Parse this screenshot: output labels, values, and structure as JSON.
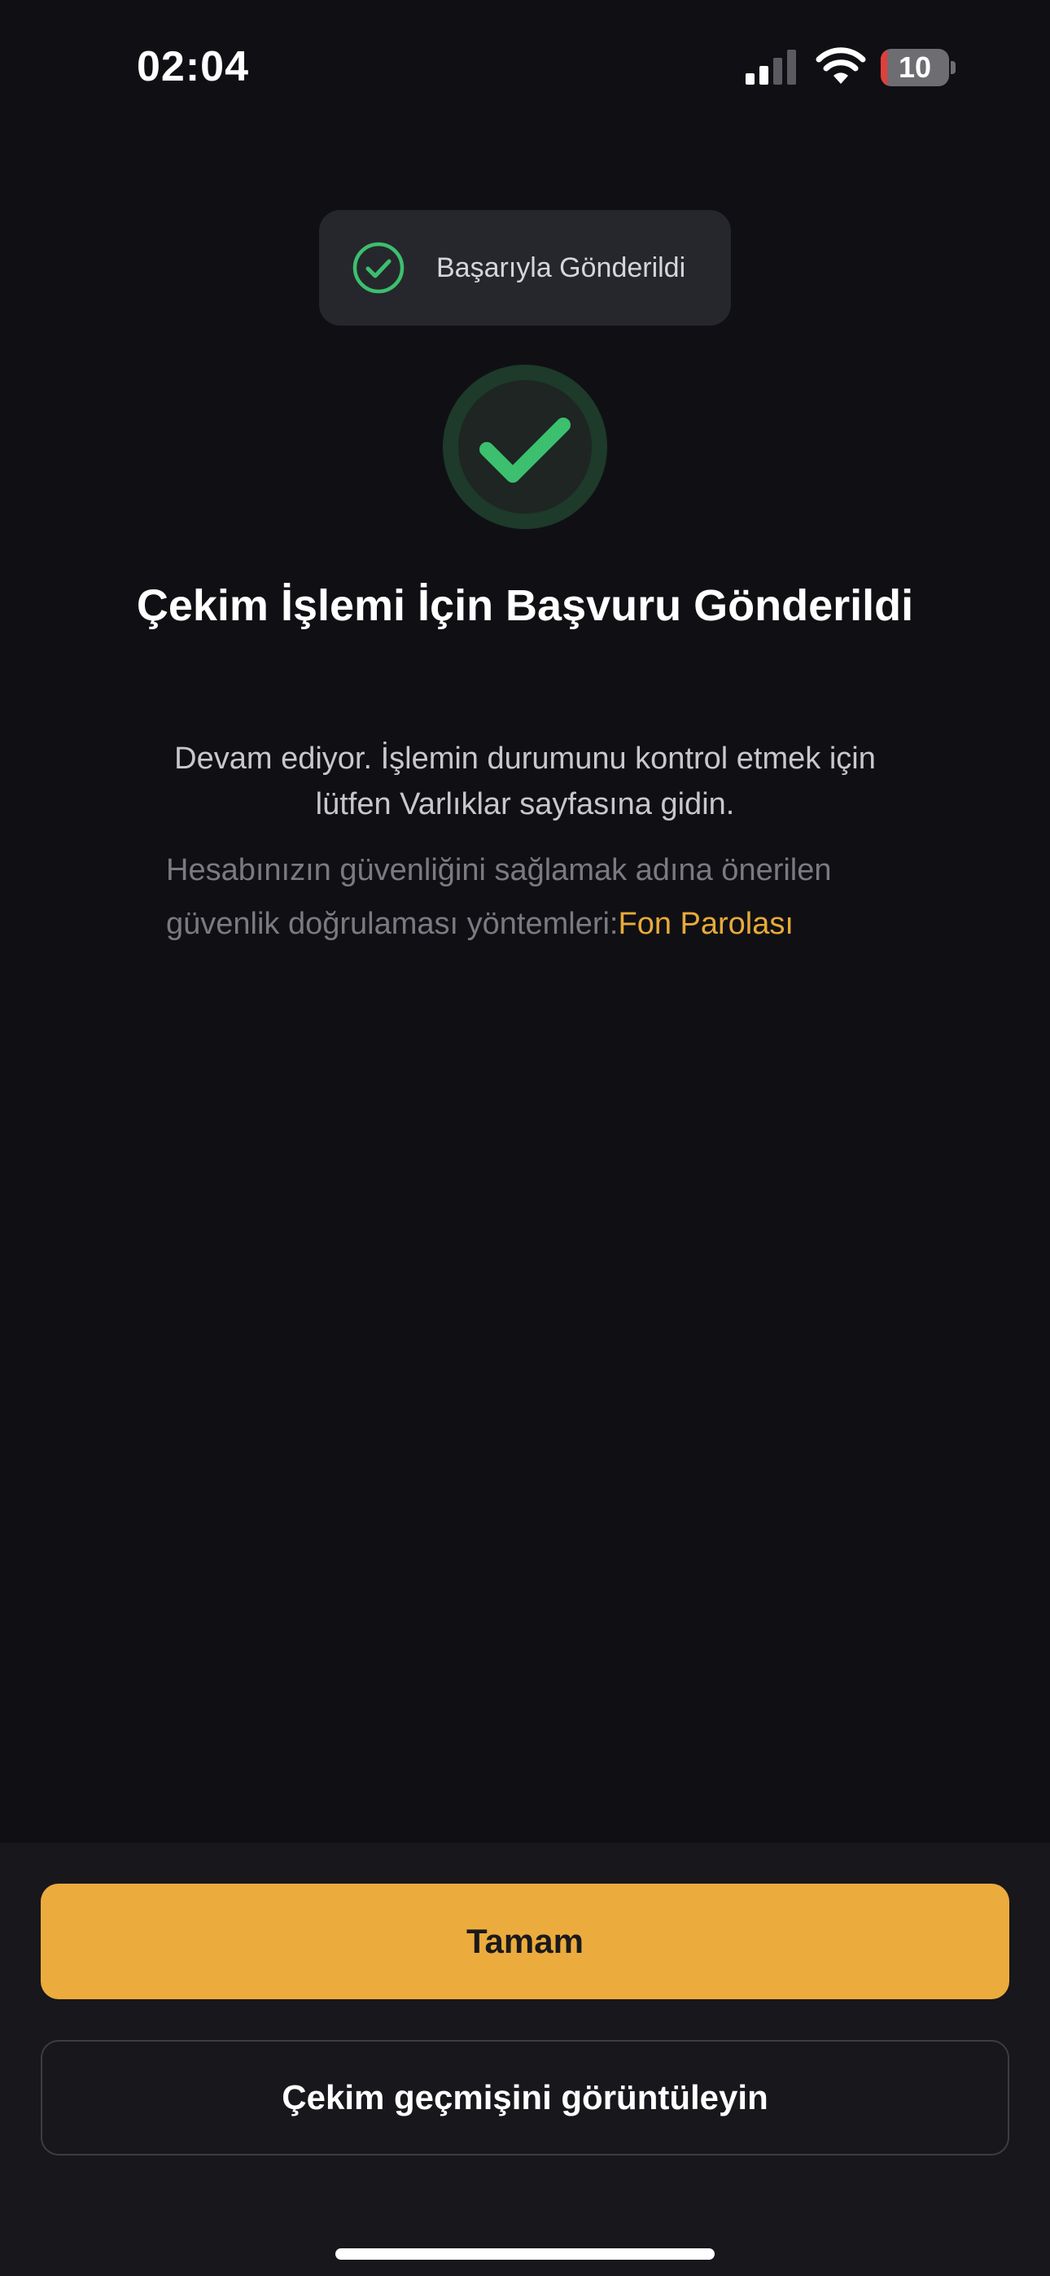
{
  "status_bar": {
    "time": "02:04",
    "battery_level": "10",
    "battery_fraction": 0.1,
    "signal_bars_active": 2,
    "signal_bars_total": 4
  },
  "toast": {
    "icon": "check-circle-icon",
    "message": "Başarıyla Gönderildi"
  },
  "success": {
    "icon": "checkmark-icon",
    "title": "Çekim İşlemi İçin Başvuru Gönderildi",
    "description": "Devam ediyor. İşlemin durumunu kontrol etmek için lütfen Varlıklar sayfasına gidin."
  },
  "security": {
    "text": "Hesabınızın güvenliğini sağlamak adına önerilen güvenlik doğrulaması yöntemleri:",
    "link_label": "Fon Parolası"
  },
  "actions": {
    "primary_label": "Tamam",
    "secondary_label": "Çekim geçmişini görüntüleyin"
  },
  "colors": {
    "background": "#101014",
    "accent": "#ecab3d",
    "success": "#3cbf6e",
    "link": "#e8aa3a"
  }
}
